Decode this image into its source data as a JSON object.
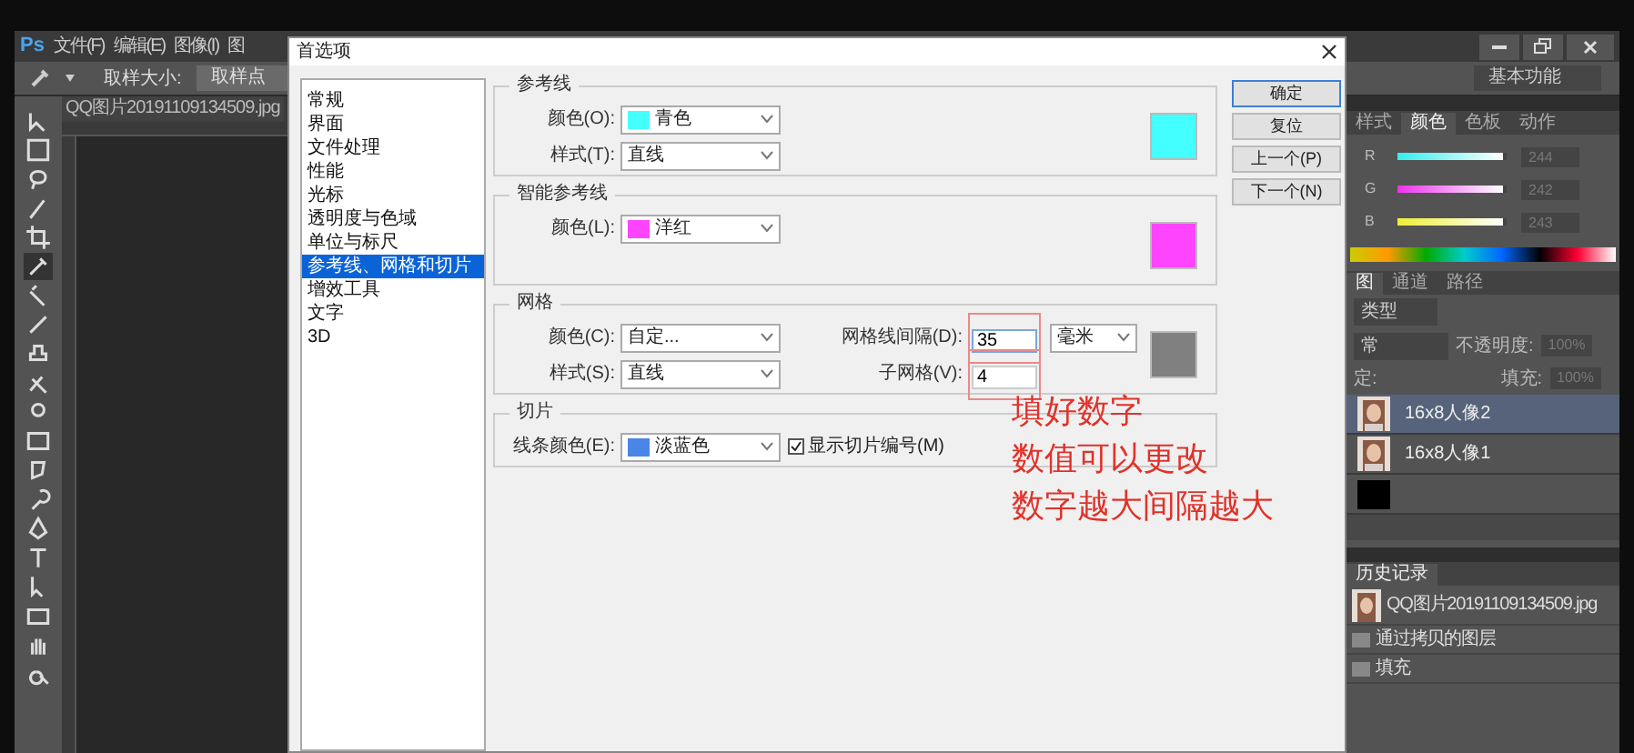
{
  "app": {
    "logo": "Ps",
    "menu": [
      "文件(F)",
      "编辑(E)",
      "图像(I)",
      "图"
    ],
    "options_bar": {
      "sample_size_label": "取样大小:",
      "sample_size": "取样点",
      "workspace": "基本功能"
    },
    "document_tab": "QQ图片20191109134509.jpg"
  },
  "dialog": {
    "title": "首选项",
    "categories": [
      {
        "label": "常规",
        "selected": false
      },
      {
        "label": "界面",
        "selected": false
      },
      {
        "label": "文件处理",
        "selected": false
      },
      {
        "label": "性能",
        "selected": false
      },
      {
        "label": "光标",
        "selected": false
      },
      {
        "label": "透明度与色域",
        "selected": false
      },
      {
        "label": "单位与标尺",
        "selected": false
      },
      {
        "label": "参考线、网格和切片",
        "selected": true
      },
      {
        "label": "增效工具",
        "selected": false
      },
      {
        "label": "文字",
        "selected": false
      },
      {
        "label": "3D",
        "selected": false
      }
    ],
    "guides": {
      "title": "参考线",
      "color_label": "颜色(O):",
      "color_name": "青色",
      "swatch": {
        "color": "#44ffff"
      },
      "style_label": "样式(T):",
      "style": "直线"
    },
    "smart_guides": {
      "title": "智能参考线",
      "color_label": "颜色(L):",
      "color_name": "洋红",
      "swatch": {
        "color": "#ff44ff"
      }
    },
    "grid": {
      "title": "网格",
      "color_label": "颜色(C):",
      "color_name": "自定...",
      "style_label": "样式(S):",
      "style": "直线",
      "gridline_label": "网格线间隔(D):",
      "gridline": "35",
      "unit": "毫米",
      "subdivisions_label": "子网格(V):",
      "subdivisions": "4",
      "swatch": {
        "color": "#808080"
      }
    },
    "slices": {
      "title": "切片",
      "line_color_label": "线条颜色(E):",
      "line_color": "淡蓝色",
      "swatch": {
        "color": "#4a86e8"
      },
      "show_numbers": {
        "label": "显示切片编号(M)",
        "checked": true
      }
    },
    "buttons": [
      "确定",
      "复位",
      "上一个(P)",
      "下一个(N)"
    ]
  },
  "annotations": [
    "填好数字",
    "数值可以更改",
    "数字越大间隔越大"
  ],
  "color_panel": {
    "tabs": [
      {
        "label": "样式",
        "selected": false
      },
      {
        "label": "颜色",
        "selected": true
      },
      {
        "label": "色板",
        "selected": false
      },
      {
        "label": "动作",
        "selected": false
      }
    ],
    "channels": [
      {
        "name": "R",
        "level": 0.96,
        "value": "244"
      },
      {
        "name": "G",
        "level": 0.96,
        "value": "242"
      },
      {
        "name": "B",
        "level": 0.96,
        "value": "243"
      }
    ]
  },
  "layers_panel": {
    "tabs": [
      {
        "label": "图",
        "selected": true
      },
      {
        "label": "通道",
        "selected": false
      },
      {
        "label": "路径",
        "selected": false
      }
    ],
    "filter": "类型",
    "blend_mode": "常",
    "opacity_label": "不透明度:",
    "opacity": "100%",
    "lock_label": "定:",
    "fill_label": "填充:",
    "fill": "100%",
    "layers": [
      {
        "name": "16x8人像2",
        "selected": true
      },
      {
        "name": "16x8人像1",
        "selected": false
      },
      {
        "kind": "black",
        "selected": false
      }
    ]
  },
  "history_panel": {
    "tabs": [
      {
        "label": "历史记录",
        "selected": true
      }
    ],
    "items": [
      {
        "kind": "snapshot",
        "name": "QQ图片20191109134509.jpg"
      },
      {
        "kind": "step",
        "name": "通过拷贝的图层"
      },
      {
        "kind": "step",
        "name": "填充"
      }
    ]
  }
}
